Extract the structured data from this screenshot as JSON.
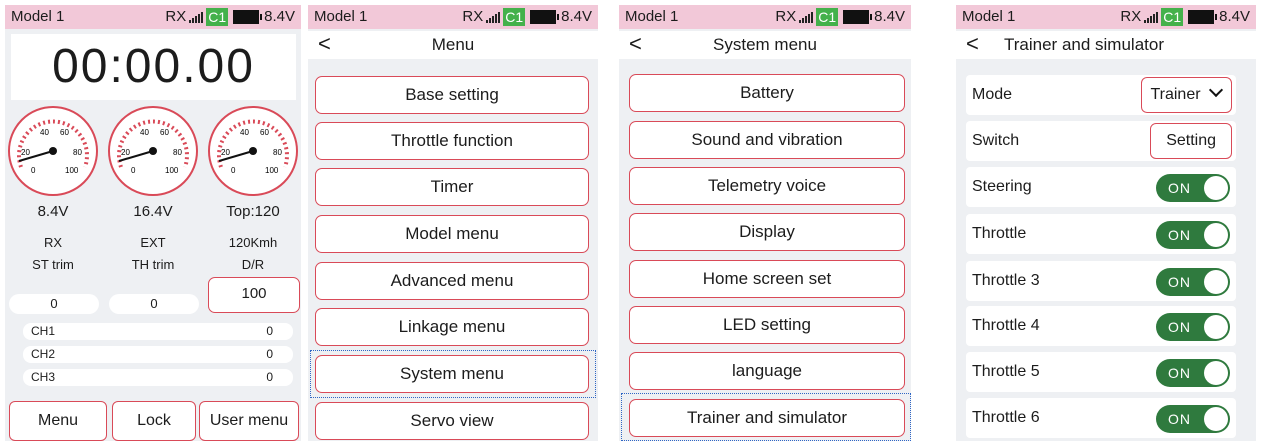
{
  "status": {
    "model": "Model 1",
    "rx": "RX",
    "channel": "C1",
    "voltage": "8.4V"
  },
  "home": {
    "timer": "00:00.00",
    "gauges": [
      {
        "ticks": [
          "40",
          "60",
          "20",
          "80",
          "0",
          "100"
        ]
      },
      {
        "ticks": [
          "40",
          "60",
          "20",
          "80",
          "0",
          "100"
        ]
      },
      {
        "ticks": [
          "40",
          "60",
          "20",
          "80",
          "0",
          "100"
        ]
      }
    ],
    "readings": [
      "8.4V",
      "16.4V",
      "Top:120"
    ],
    "sources": [
      "RX",
      "EXT",
      "120Kmh"
    ],
    "trims": {
      "st_label": "ST trim",
      "th_label": "TH trim",
      "dr_label": "D/R",
      "st_value": "0",
      "th_value": "0",
      "dr_value": "100"
    },
    "channels": [
      {
        "name": "CH1",
        "value": "0"
      },
      {
        "name": "CH2",
        "value": "0"
      },
      {
        "name": "CH3",
        "value": "0"
      }
    ],
    "buttons": {
      "menu": "Menu",
      "lock": "Lock",
      "user_menu": "User menu"
    }
  },
  "menu": {
    "title": "Menu",
    "back": "<",
    "items": [
      "Base setting",
      "Throttle function",
      "Timer",
      "Model menu",
      "Advanced menu",
      "Linkage menu",
      "System menu",
      "Servo view"
    ]
  },
  "system_menu": {
    "title": "System menu",
    "back": "<",
    "items": [
      "Battery",
      "Sound and vibration",
      "Telemetry voice",
      "Display",
      "Home screen set",
      "LED setting",
      "language",
      "Trainer and simulator"
    ]
  },
  "trainer": {
    "title": "Trainer and simulator",
    "back": "<",
    "mode_label": "Mode",
    "mode_value": "Trainer",
    "switch_label": "Switch",
    "switch_button": "Setting",
    "toggles": [
      {
        "label": "Steering",
        "state": "ON"
      },
      {
        "label": "Throttle",
        "state": "ON"
      },
      {
        "label": "Throttle 3",
        "state": "ON"
      },
      {
        "label": "Throttle 4",
        "state": "ON"
      },
      {
        "label": "Throttle 5",
        "state": "ON"
      },
      {
        "label": "Throttle 6",
        "state": "ON"
      }
    ]
  },
  "colors": {
    "accent_red": "#d94a58",
    "toggle_green": "#2f7a3e",
    "status_pink": "#f2c8d8",
    "c1_green": "#44b14b",
    "selection_blue": "#2f66c5"
  }
}
